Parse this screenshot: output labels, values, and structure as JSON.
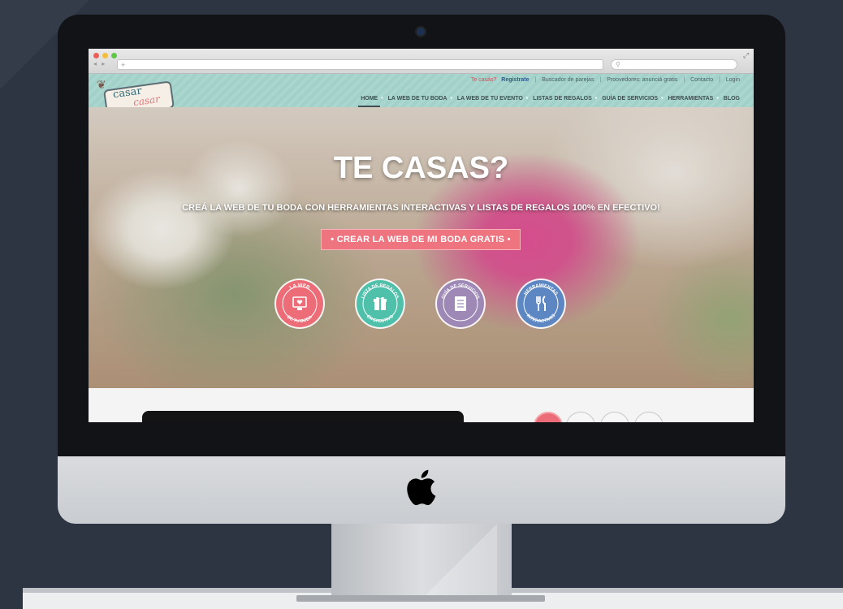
{
  "browser": {
    "url_placeholder": "+",
    "search_placeholder": ""
  },
  "site": {
    "logo": {
      "line1": "casar",
      "line2": "casar"
    },
    "toplinks": {
      "question": "Te casás?",
      "register": "Registrate",
      "partner_search": "Buscador de parejas",
      "providers": "Proovedores: anunciá gratis",
      "contact": "Contacto",
      "login": "Login"
    },
    "nav": [
      {
        "label": "HOME",
        "active": true
      },
      {
        "label": "LA WEB DE TU BODA"
      },
      {
        "label": "LA WEB DE TU EVENTO"
      },
      {
        "label": "LISTAS DE REGALOS"
      },
      {
        "label": "GUÍA DE SERVICIOS"
      },
      {
        "label": "HERRAMIENTAS"
      },
      {
        "label": "BLOG"
      }
    ],
    "hero": {
      "title": "TE CASAS?",
      "subtitle": "CREÁ LA WEB DE TU BODA CON HERRAMIENTAS INTERACTIVAS Y LISTAS DE REGALOS 100% EN EFECTIVO!",
      "cta": "• CREAR LA WEB DE MI BODA GRATIS •"
    },
    "badges": [
      {
        "top": "LA WEB",
        "bottom": "DE TU BODA",
        "color": "#ec6d77",
        "icon": "monitor-heart-icon"
      },
      {
        "top": "LISTA DE REGALOS",
        "bottom": "EN EFECTIVO",
        "color": "#4fc1ab",
        "icon": "gift-icon"
      },
      {
        "top": "GUÍA DE SERVICIOS",
        "bottom": "",
        "color": "#9d88b6",
        "icon": "notebook-icon"
      },
      {
        "top": "HERRAMIENTAS",
        "bottom": "INTERACTIVAS",
        "color": "#5d87c2",
        "icon": "utensils-icon"
      }
    ]
  },
  "colors": {
    "header_teal": "#a9d6cf",
    "cta_pink": "#ee7580",
    "badge_pink": "#ec6d77",
    "badge_teal": "#4fc1ab",
    "badge_purple": "#9d88b6",
    "badge_blue": "#5d87c2"
  }
}
